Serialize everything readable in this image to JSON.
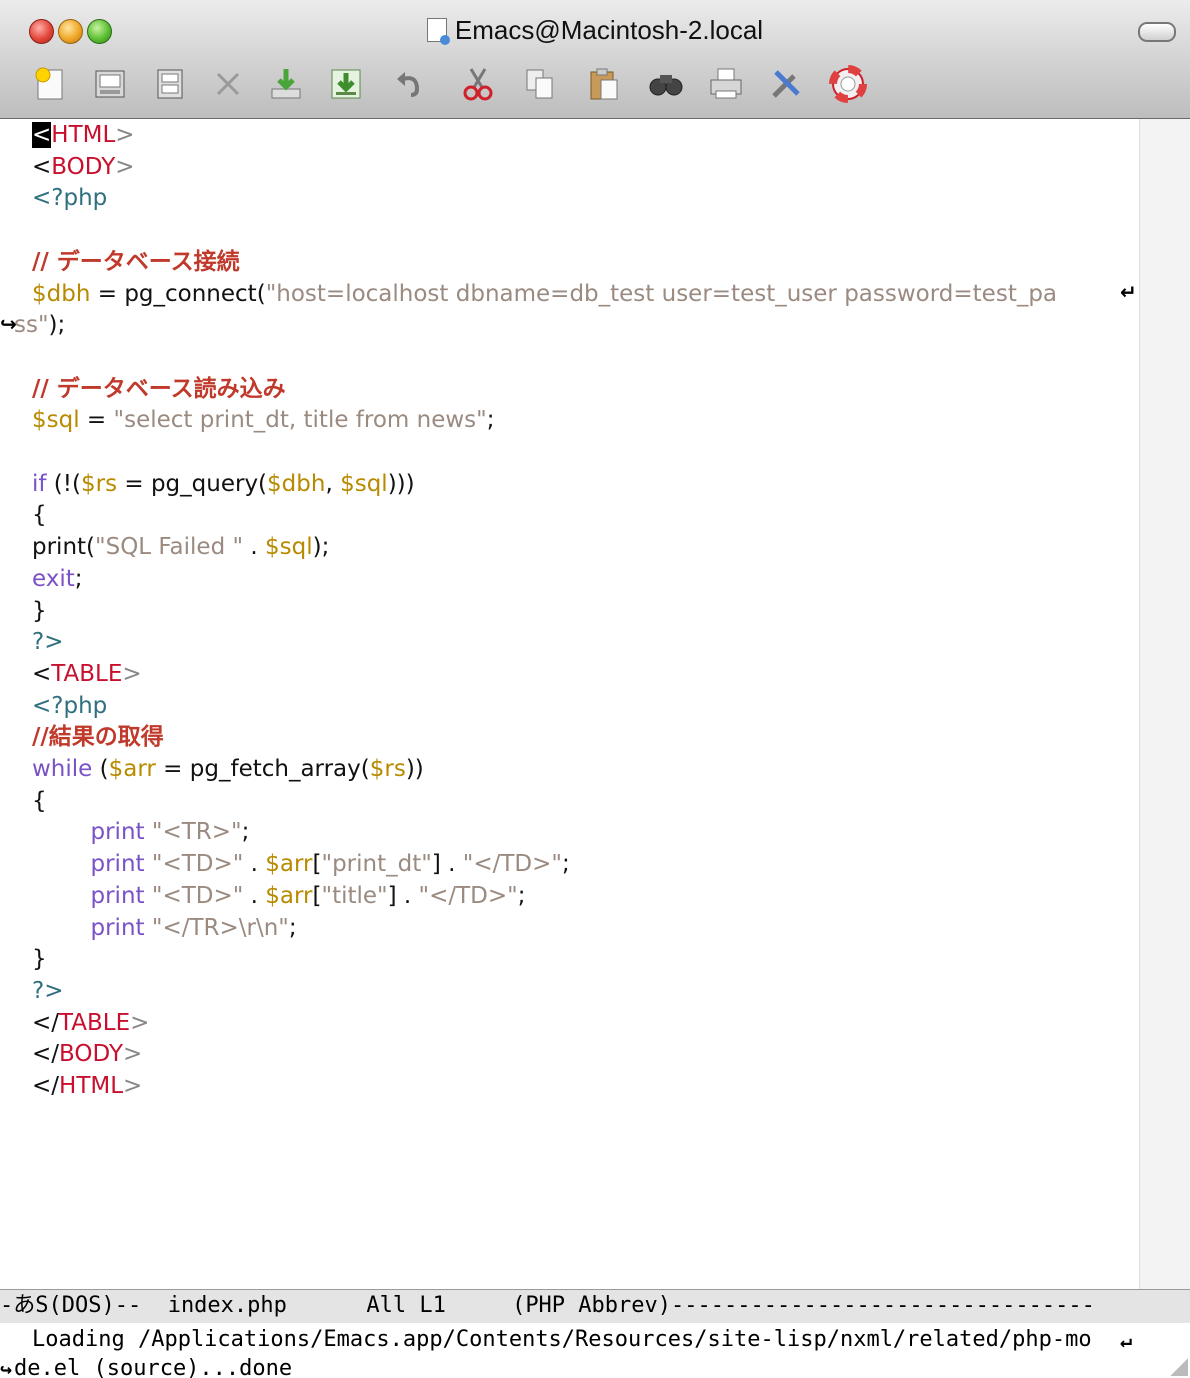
{
  "window": {
    "title": "Emacs@Macintosh-2.local"
  },
  "toolbar": {
    "icons": [
      "new-file-icon",
      "open-file-icon",
      "dired-icon",
      "close-buffer-icon",
      "save-icon",
      "save-as-icon",
      "undo-icon",
      "cut-icon",
      "copy-icon",
      "paste-icon",
      "search-icon",
      "print-icon",
      "preferences-icon",
      "help-icon"
    ]
  },
  "editor": {
    "lines": [
      [
        [
          "cursor",
          "<"
        ],
        [
          "tag",
          "HTML"
        ],
        [
          "angg",
          ">"
        ]
      ],
      [
        [
          "ang",
          "<"
        ],
        [
          "tag",
          "BODY"
        ],
        [
          "angg",
          ">"
        ]
      ],
      [
        [
          "pi",
          "<?php"
        ]
      ],
      [],
      [
        [
          "cmt",
          "// データベース接続"
        ]
      ],
      [
        [
          "var",
          "$"
        ],
        [
          "var",
          "dbh"
        ],
        [
          "plain",
          " = pg_connect("
        ],
        [
          "str",
          "\"host=localhost dbname=db_test user=test_user password=test_pa"
        ]
      ],
      [
        [
          "str",
          "ss\""
        ],
        [
          "plain",
          ");"
        ]
      ],
      [],
      [
        [
          "cmt",
          "// データベース読み込み"
        ]
      ],
      [
        [
          "var",
          "$sql"
        ],
        [
          "plain",
          " = "
        ],
        [
          "str",
          "\"select print_dt, title from news\""
        ],
        [
          "plain",
          ";"
        ]
      ],
      [],
      [
        [
          "kw",
          "if"
        ],
        [
          "plain",
          " (!("
        ],
        [
          "var",
          "$rs"
        ],
        [
          "plain",
          " = pg_query("
        ],
        [
          "var",
          "$dbh"
        ],
        [
          "plain",
          ", "
        ],
        [
          "var",
          "$sql"
        ],
        [
          "plain",
          ")))"
        ]
      ],
      [
        [
          "plain",
          "{"
        ]
      ],
      [
        [
          "plain",
          "print("
        ],
        [
          "str",
          "\"SQL Failed \""
        ],
        [
          "plain",
          " . "
        ],
        [
          "var",
          "$sql"
        ],
        [
          "plain",
          ");"
        ]
      ],
      [
        [
          "kw",
          "exit"
        ],
        [
          "plain",
          ";"
        ]
      ],
      [
        [
          "plain",
          "}"
        ]
      ],
      [
        [
          "pi",
          "?>"
        ]
      ],
      [
        [
          "ang",
          "<"
        ],
        [
          "tag",
          "TABLE"
        ],
        [
          "angg",
          ">"
        ]
      ],
      [
        [
          "pi",
          "<?php"
        ]
      ],
      [
        [
          "cmt",
          "//結果の取得"
        ]
      ],
      [
        [
          "kw",
          "while"
        ],
        [
          "plain",
          " ("
        ],
        [
          "var",
          "$arr"
        ],
        [
          "plain",
          " = pg_fetch_array("
        ],
        [
          "var",
          "$rs"
        ],
        [
          "plain",
          "))"
        ]
      ],
      [
        [
          "plain",
          "{"
        ]
      ],
      [
        [
          "plain",
          "        "
        ],
        [
          "kw",
          "print"
        ],
        [
          "plain",
          " "
        ],
        [
          "str",
          "\"<TR>\""
        ],
        [
          "plain",
          ";"
        ]
      ],
      [
        [
          "plain",
          "        "
        ],
        [
          "kw",
          "print"
        ],
        [
          "plain",
          " "
        ],
        [
          "str",
          "\"<TD>\""
        ],
        [
          "plain",
          " . "
        ],
        [
          "var",
          "$arr"
        ],
        [
          "plain",
          "["
        ],
        [
          "str",
          "\"print_dt\""
        ],
        [
          "plain",
          "] . "
        ],
        [
          "str",
          "\"</TD>\""
        ],
        [
          "plain",
          ";"
        ]
      ],
      [
        [
          "plain",
          "        "
        ],
        [
          "kw",
          "print"
        ],
        [
          "plain",
          " "
        ],
        [
          "str",
          "\"<TD>\""
        ],
        [
          "plain",
          " . "
        ],
        [
          "var",
          "$arr"
        ],
        [
          "plain",
          "["
        ],
        [
          "str",
          "\"title\""
        ],
        [
          "plain",
          "] . "
        ],
        [
          "str",
          "\"</TD>\""
        ],
        [
          "plain",
          ";"
        ]
      ],
      [
        [
          "plain",
          "        "
        ],
        [
          "kw",
          "print"
        ],
        [
          "plain",
          " "
        ],
        [
          "str",
          "\"</TR>\\r\\n\""
        ],
        [
          "plain",
          ";"
        ]
      ],
      [
        [
          "plain",
          "}"
        ]
      ],
      [
        [
          "pi",
          "?>"
        ]
      ],
      [
        [
          "ang",
          "</"
        ],
        [
          "tag",
          "TABLE"
        ],
        [
          "angg",
          ">"
        ]
      ],
      [
        [
          "ang",
          "</"
        ],
        [
          "tag",
          "BODY"
        ],
        [
          "angg",
          ">"
        ]
      ],
      [
        [
          "ang",
          "</"
        ],
        [
          "tag",
          "HTML"
        ],
        [
          "angg",
          ">"
        ]
      ]
    ],
    "wrapped_lines": [
      6
    ]
  },
  "modeline": {
    "text": "-あS(DOS)--  index.php      All L1     (PHP Abbrev)--------------------------------"
  },
  "minibuffer": {
    "line1": "Loading /Applications/Emacs.app/Contents/Resources/site-lisp/nxml/related/php-mo",
    "line2": "de.el (source)...done"
  }
}
